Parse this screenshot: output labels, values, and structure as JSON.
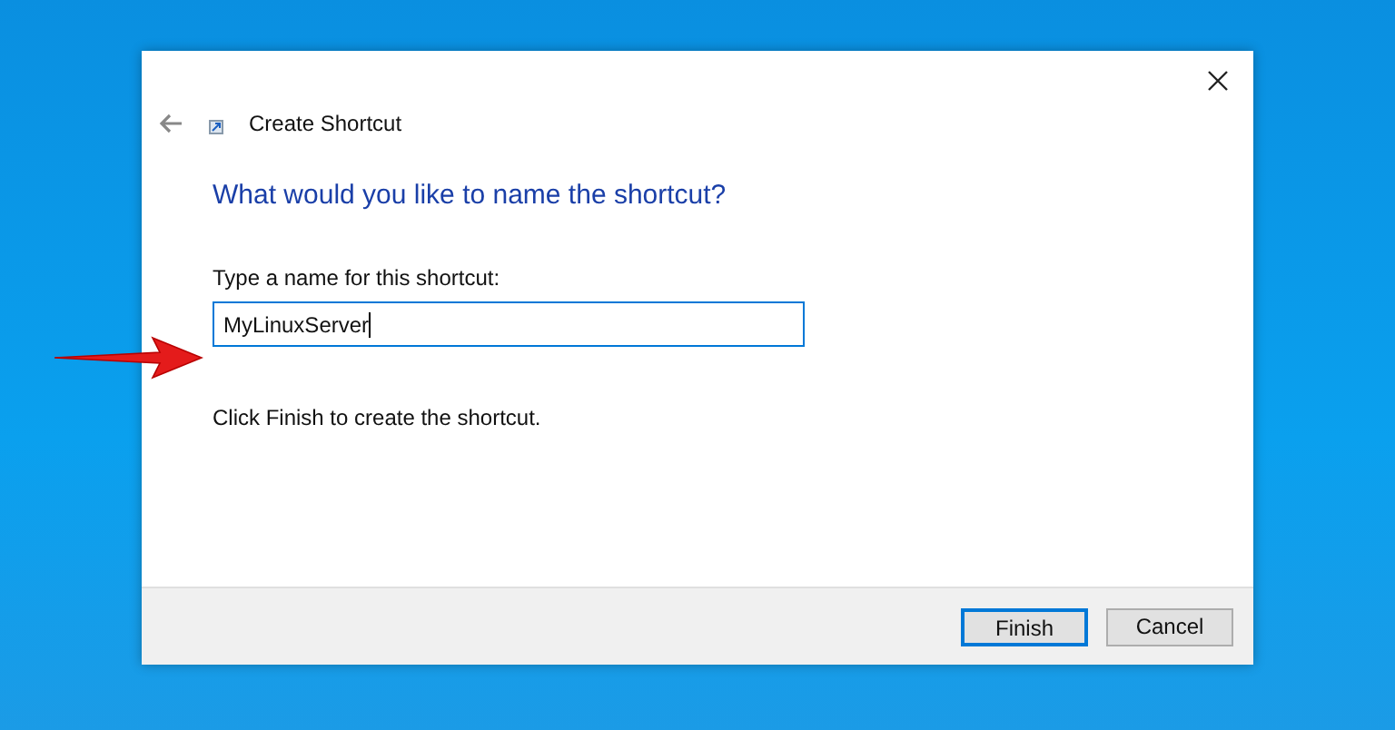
{
  "window": {
    "title": "Create Shortcut"
  },
  "heading": "What would you like to name the shortcut?",
  "name_field": {
    "label": "Type a name for this shortcut:",
    "value": "MyLinuxServer",
    "focused": true
  },
  "hint": "Click Finish to create the shortcut.",
  "buttons": [
    {
      "label": "Finish",
      "default": true
    },
    {
      "label": "Cancel",
      "default": false
    }
  ]
}
